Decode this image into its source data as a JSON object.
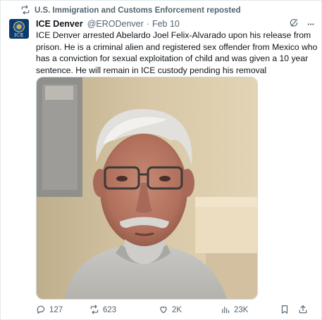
{
  "repost_banner": {
    "text": "U.S. Immigration and Customs Enforcement reposted",
    "icon": "repost-icon"
  },
  "author": {
    "avatar_text": "ICE",
    "name": "ICE Denver",
    "handle": "@ERODenver",
    "separator": "·",
    "date": "Feb 10"
  },
  "header_actions": {
    "grok_icon": "grok-icon",
    "more_label": "···"
  },
  "tweet": {
    "text": "ICE Denver arrested Abelardo Joel Felix-Alvarado upon his release from\nprison. He is a criminal alien and registered sex offender from Mexico who\nhas a conviction for sexual exploitation of  child and was given a 10 year\nsentence. He will remain in ICE custody pending his removal"
  },
  "media": {
    "kind": "photo"
  },
  "actions": {
    "replies": "127",
    "reposts": "623",
    "likes": "2K",
    "views": "23K",
    "colors": {
      "icon": "#536471",
      "repost_active": "#536471"
    }
  }
}
